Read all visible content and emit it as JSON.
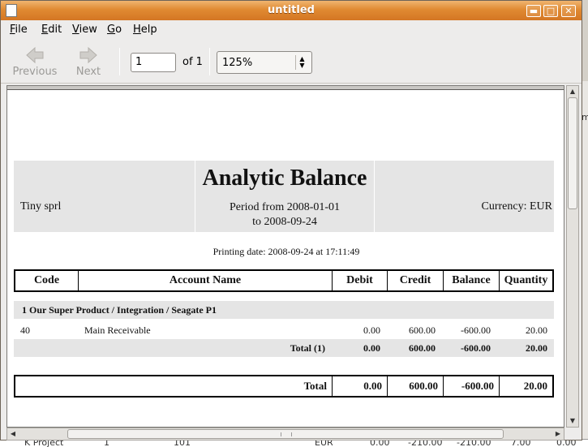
{
  "window": {
    "title": "untitled",
    "buttons": {
      "minimize": "▬",
      "maximize": "□",
      "close": "✕"
    }
  },
  "menu": [
    {
      "key": "F",
      "rest": "ile"
    },
    {
      "key": "E",
      "rest": "dit"
    },
    {
      "key": "V",
      "rest": "iew"
    },
    {
      "key": "G",
      "rest": "o"
    },
    {
      "key": "H",
      "rest": "elp"
    }
  ],
  "toolbar": {
    "previous_label": "Previous",
    "next_label": "Next",
    "page_value": "1",
    "of_label": "of 1",
    "zoom_value": "125%"
  },
  "report": {
    "title": "Analytic Balance",
    "company": "Tiny sprl",
    "period_line1": "Period from 2008-01-01",
    "period_line2": "to 2008-09-24",
    "currency": "Currency: EUR",
    "printing_date": "Printing date: 2008-09-24 at 17:11:49",
    "columns": [
      "Code",
      "Account Name",
      "Debit",
      "Credit",
      "Balance",
      "Quantity"
    ],
    "group_title": "1 Our Super Product / Integration / Seagate P1",
    "row": {
      "code": "40",
      "name": "Main Receivable",
      "debit": "0.00",
      "credit": "600.00",
      "balance": "-600.00",
      "quantity": "20.00"
    },
    "subtotal": {
      "label": "Total (1)",
      "debit": "0.00",
      "credit": "600.00",
      "balance": "-600.00",
      "quantity": "20.00"
    },
    "grand_total": {
      "label": "Total",
      "debit": "0.00",
      "credit": "600.00",
      "balance": "-600.00",
      "quantity": "20.00"
    }
  },
  "background": {
    "right_edge_text": "m",
    "bottom_strip": {
      "c1": "K  Project",
      "c2": "1",
      "c3": "101",
      "c4": "EUR",
      "c5": "0.00",
      "c6": "-210.00",
      "c7": "-210.00",
      "c8": "7.00",
      "c9": "0.00"
    }
  }
}
